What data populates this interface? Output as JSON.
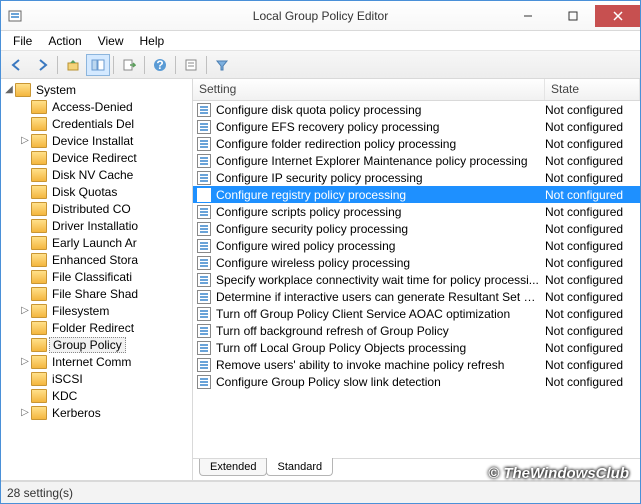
{
  "title": "Local Group Policy Editor",
  "menu": [
    "File",
    "Action",
    "View",
    "Help"
  ],
  "tree": {
    "root": {
      "label": "System",
      "expanded": true
    },
    "children": [
      "Access-Denied",
      "Credentials Del",
      "Device Installat",
      "Device Redirect",
      "Disk NV Cache",
      "Disk Quotas",
      "Distributed CO",
      "Driver Installatio",
      "Early Launch Ar",
      "Enhanced Stora",
      "File Classificati",
      "File Share Shad",
      "Filesystem",
      "Folder Redirect",
      "Group Policy",
      "Internet Comm",
      "iSCSI",
      "KDC",
      "Kerberos"
    ],
    "selected": "Group Policy",
    "expandable": [
      "Device Installat",
      "Filesystem",
      "Internet Comm",
      "Kerberos"
    ]
  },
  "columns": {
    "setting": "Setting",
    "state": "State"
  },
  "rows": [
    {
      "s": "Configure disk quota policy processing",
      "st": "Not configured"
    },
    {
      "s": "Configure EFS recovery policy processing",
      "st": "Not configured"
    },
    {
      "s": "Configure folder redirection policy processing",
      "st": "Not configured"
    },
    {
      "s": "Configure Internet Explorer Maintenance policy processing",
      "st": "Not configured"
    },
    {
      "s": "Configure IP security policy processing",
      "st": "Not configured"
    },
    {
      "s": "Configure registry policy processing",
      "st": "Not configured",
      "selected": true
    },
    {
      "s": "Configure scripts policy processing",
      "st": "Not configured"
    },
    {
      "s": "Configure security policy processing",
      "st": "Not configured"
    },
    {
      "s": "Configure wired policy processing",
      "st": "Not configured"
    },
    {
      "s": "Configure wireless policy processing",
      "st": "Not configured"
    },
    {
      "s": "Specify workplace connectivity wait time for policy processi...",
      "st": "Not configured"
    },
    {
      "s": "Determine if interactive users can generate Resultant Set of ...",
      "st": "Not configured"
    },
    {
      "s": "Turn off Group Policy Client Service AOAC optimization",
      "st": "Not configured"
    },
    {
      "s": "Turn off background refresh of Group Policy",
      "st": "Not configured"
    },
    {
      "s": "Turn off Local Group Policy Objects processing",
      "st": "Not configured"
    },
    {
      "s": "Remove users' ability to invoke machine policy refresh",
      "st": "Not configured"
    },
    {
      "s": "Configure Group Policy slow link detection",
      "st": "Not configured"
    }
  ],
  "tabs": {
    "extended": "Extended",
    "standard": "Standard",
    "active": "standard"
  },
  "status": "28 setting(s)",
  "watermark": "© TheWindowsClub"
}
